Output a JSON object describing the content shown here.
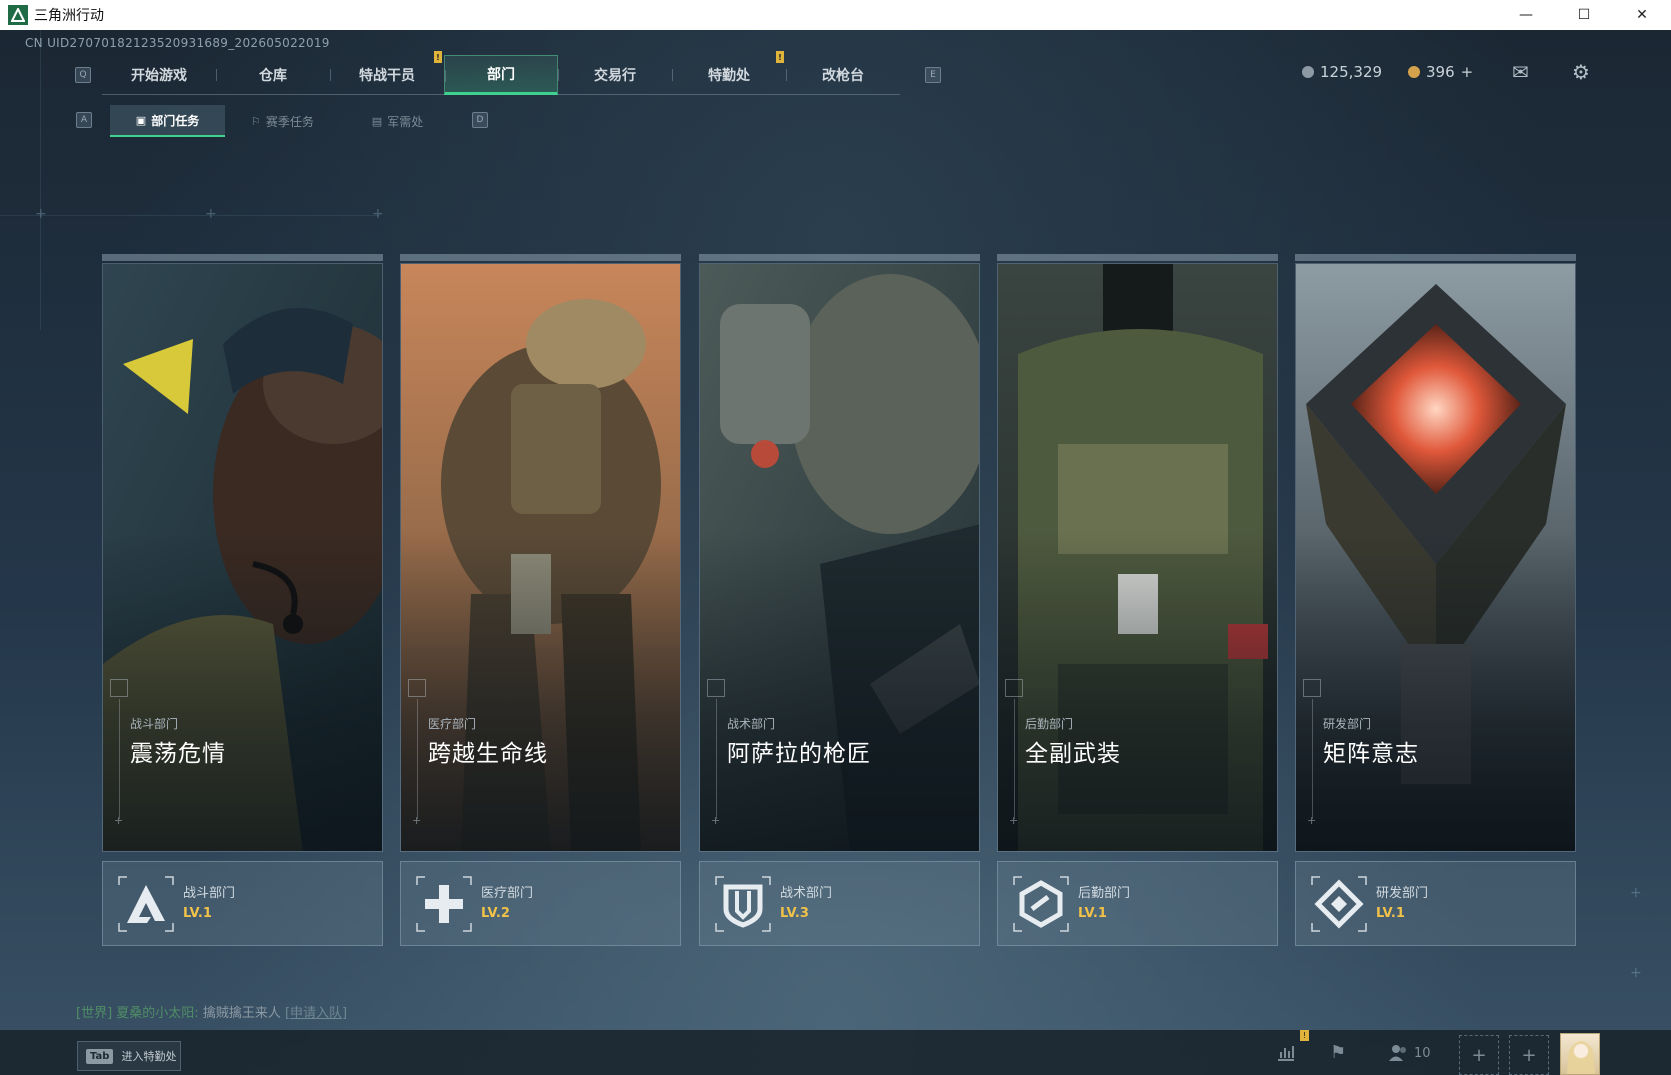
{
  "window": {
    "title": "三角洲行动",
    "controls": [
      "minimize",
      "maximize",
      "close"
    ]
  },
  "uid": "CN UID27070182123520931689_202605022019",
  "main_nav": {
    "left_key": "Q",
    "right_key": "E",
    "tabs": [
      {
        "label": "开始游戏",
        "alert": false
      },
      {
        "label": "仓库",
        "alert": false
      },
      {
        "label": "特战干员",
        "alert": true
      },
      {
        "label": "部门",
        "active": true
      },
      {
        "label": "交易行",
        "alert": false
      },
      {
        "label": "特勤处",
        "alert": true
      },
      {
        "label": "改枪台",
        "alert": false
      }
    ]
  },
  "sub_nav": {
    "left_key": "A",
    "right_key": "D",
    "tabs": [
      {
        "label": "部门任务",
        "icon": "task-icon",
        "active": true
      },
      {
        "label": "赛季任务",
        "icon": "season-icon"
      },
      {
        "label": "军需处",
        "icon": "supply-icon"
      }
    ]
  },
  "currency": {
    "coins": "125,329",
    "tickets": "396",
    "tickets_add": "+",
    "coins_color": "#8e9aa3",
    "tickets_color": "#d4a24a"
  },
  "top_icons": {
    "mail": "mail-icon",
    "settings": "gear-icon"
  },
  "departments": [
    {
      "category": "战斗部门",
      "title": "震荡危情",
      "level_name": "战斗部门",
      "level": "LV.1",
      "icon": "combat-icon"
    },
    {
      "category": "医疗部门",
      "title": "跨越生命线",
      "level_name": "医疗部门",
      "level": "LV.2",
      "icon": "medical-cross-icon"
    },
    {
      "category": "战术部门",
      "title": "阿萨拉的枪匠",
      "level_name": "战术部门",
      "level": "LV.3",
      "icon": "tactical-shield-icon"
    },
    {
      "category": "后勤部门",
      "title": "全副武装",
      "level_name": "后勤部门",
      "level": "LV.1",
      "icon": "logistics-icon"
    },
    {
      "category": "研发部门",
      "title": "矩阵意志",
      "level_name": "研发部门",
      "level": "LV.1",
      "icon": "research-icon"
    }
  ],
  "chat": {
    "channel": "[世界]",
    "sender": "夏桑的小太阳:",
    "message": "擒贼擒王来人",
    "action": "[申请入队]"
  },
  "bottom": {
    "tab_key": "Tab",
    "tab_label": "进入特勤处",
    "friends_count": "10",
    "accent": "#3fd28e",
    "alert": "!"
  }
}
